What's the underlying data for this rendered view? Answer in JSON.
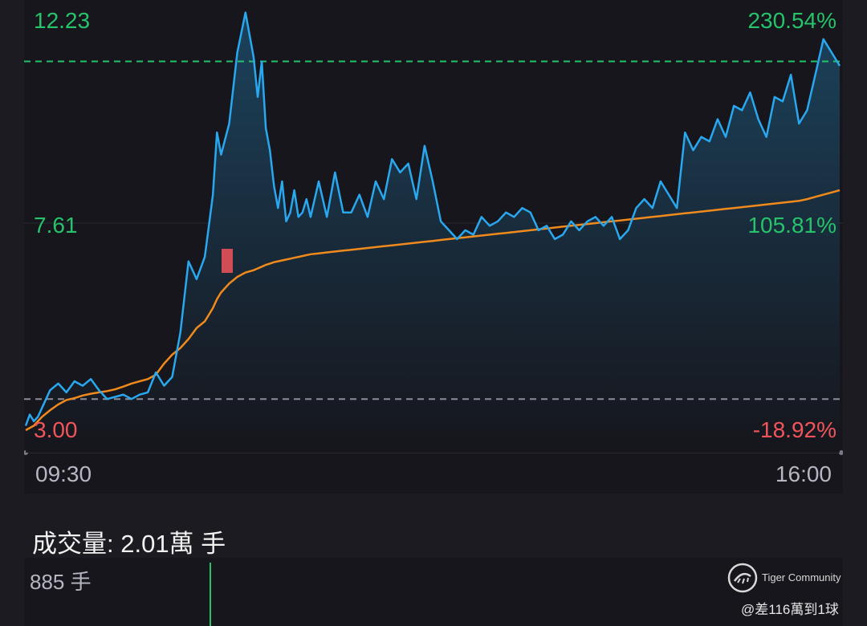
{
  "chart_data": {
    "type": "line",
    "y_axis_left": {
      "max": 12.23,
      "mid": 7.61,
      "min": 3.0,
      "labels": [
        "12.23",
        "7.61",
        "3.00"
      ]
    },
    "y_axis_right": {
      "labels": [
        "230.54%",
        "105.81%",
        "-18.92%"
      ]
    },
    "x_axis": {
      "start": "09:30",
      "end": "16:00"
    },
    "reference_lines": {
      "high": 11.3,
      "prev_close": 3.7
    },
    "colors": {
      "price": "#29a8f0",
      "avg": "#f08a1c",
      "up": "#27c36a",
      "down": "#f2545b",
      "grid": "#2c2c35"
    },
    "series": [
      {
        "x": [
          0,
          0.005,
          0.01,
          0.015,
          0.02,
          0.03,
          0.04,
          0.05,
          0.06,
          0.07,
          0.08,
          0.09,
          0.1,
          0.11,
          0.12,
          0.13,
          0.14,
          0.15,
          0.16,
          0.17,
          0.18,
          0.19,
          0.2,
          0.21,
          0.22,
          0.225,
          0.23,
          0.235,
          0.24,
          0.25,
          0.26,
          0.27,
          0.28,
          0.285,
          0.29,
          0.295,
          0.3,
          0.305,
          0.31,
          0.315,
          0.32,
          0.325,
          0.33,
          0.335,
          0.34,
          0.345,
          0.35,
          0.36,
          0.37,
          0.38,
          0.39,
          0.4,
          0.41,
          0.42,
          0.43,
          0.44,
          0.45,
          0.46,
          0.47,
          0.48,
          0.49,
          0.5,
          0.51,
          0.52,
          0.53,
          0.54,
          0.55,
          0.56,
          0.57,
          0.58,
          0.59,
          0.6,
          0.61,
          0.62,
          0.63,
          0.64,
          0.65,
          0.66,
          0.67,
          0.68,
          0.69,
          0.7,
          0.71,
          0.72,
          0.73,
          0.74,
          0.75,
          0.76,
          0.77,
          0.78,
          0.79,
          0.8,
          0.81,
          0.82,
          0.83,
          0.84,
          0.85,
          0.86,
          0.87,
          0.88,
          0.89,
          0.9,
          0.91,
          0.92,
          0.93,
          0.94,
          0.95,
          0.96,
          0.97,
          0.98,
          0.99,
          1.0
        ],
        "values": [
          3.1,
          3.35,
          3.2,
          3.3,
          3.5,
          3.9,
          4.05,
          3.85,
          4.1,
          4.0,
          4.15,
          3.9,
          3.7,
          3.75,
          3.8,
          3.7,
          3.8,
          3.85,
          4.3,
          4.0,
          4.2,
          5.2,
          6.8,
          6.4,
          6.9,
          7.6,
          8.3,
          9.7,
          9.2,
          9.9,
          11.5,
          12.4,
          11.4,
          10.5,
          11.3,
          9.8,
          9.3,
          8.5,
          8.0,
          8.6,
          7.7,
          7.9,
          8.4,
          7.8,
          7.9,
          8.2,
          7.8,
          8.6,
          7.8,
          8.8,
          7.9,
          7.9,
          8.3,
          7.8,
          8.6,
          8.2,
          9.1,
          8.8,
          9.0,
          8.2,
          9.4,
          8.6,
          7.7,
          7.5,
          7.3,
          7.5,
          7.4,
          7.8,
          7.6,
          7.7,
          7.9,
          7.8,
          8.0,
          7.9,
          7.5,
          7.6,
          7.3,
          7.4,
          7.7,
          7.5,
          7.7,
          7.8,
          7.6,
          7.8,
          7.3,
          7.5,
          8.0,
          8.2,
          8.0,
          8.6,
          8.3,
          8.0,
          9.7,
          9.3,
          9.6,
          9.5,
          10.0,
          9.6,
          10.3,
          10.2,
          10.6,
          10.0,
          9.6,
          10.5,
          10.4,
          11.0,
          9.9,
          10.2,
          11.0,
          11.8,
          11.5,
          11.2
        ],
        "avg_values": [
          3.0,
          3.05,
          3.1,
          3.2,
          3.3,
          3.45,
          3.58,
          3.68,
          3.72,
          3.78,
          3.82,
          3.85,
          3.88,
          3.92,
          3.98,
          4.05,
          4.1,
          4.15,
          4.25,
          4.5,
          4.7,
          4.85,
          5.05,
          5.3,
          5.45,
          5.6,
          5.75,
          5.95,
          6.1,
          6.3,
          6.45,
          6.55,
          6.6,
          6.64,
          6.68,
          6.72,
          6.75,
          6.78,
          6.8,
          6.82,
          6.84,
          6.86,
          6.88,
          6.9,
          6.92,
          6.94,
          6.96,
          6.98,
          7.0,
          7.02,
          7.04,
          7.06,
          7.08,
          7.1,
          7.12,
          7.14,
          7.16,
          7.18,
          7.2,
          7.22,
          7.24,
          7.26,
          7.28,
          7.3,
          7.32,
          7.34,
          7.36,
          7.38,
          7.4,
          7.42,
          7.44,
          7.46,
          7.48,
          7.5,
          7.52,
          7.54,
          7.56,
          7.58,
          7.6,
          7.62,
          7.64,
          7.66,
          7.68,
          7.7,
          7.72,
          7.74,
          7.76,
          7.78,
          7.8,
          7.82,
          7.84,
          7.86,
          7.88,
          7.9,
          7.92,
          7.94,
          7.96,
          7.98,
          8.0,
          8.02,
          8.04,
          8.06,
          8.08,
          8.1,
          8.12,
          8.14,
          8.16,
          8.2,
          8.25,
          8.3,
          8.35,
          8.4
        ]
      }
    ]
  },
  "volume": {
    "title": "成交量:  2.01萬 手",
    "max_label": "885 手"
  },
  "watermark": {
    "brand": "Tiger Community",
    "user": "@差116萬到1球"
  }
}
